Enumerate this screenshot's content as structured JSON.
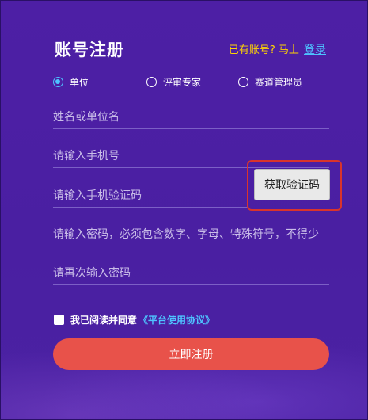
{
  "header": {
    "title": "账号注册",
    "login_hint": "已有账号? 马上",
    "login_link": "登录"
  },
  "roles": {
    "options": [
      "单位",
      "评审专家",
      "赛道管理员"
    ],
    "selected": "单位"
  },
  "fields": {
    "name_placeholder": "姓名或单位名",
    "phone_placeholder": "请输入手机号",
    "sms_code_placeholder": "请输入手机验证码",
    "password_placeholder": "请输入密码，必须包含数字、字母、特殊符号，不得少",
    "confirm_password_placeholder": "请再次输入密码"
  },
  "get_code_label": "获取验证码",
  "agreement": {
    "text": "我已阅读并同意",
    "link": "《平台使用协议》",
    "checked": false
  },
  "submit_label": "立即注册",
  "colors": {
    "background": "#4a1fa2",
    "accent_yellow": "#ffd400",
    "link_blue": "#4ec3ff",
    "submit_red": "#e8524a",
    "highlight_outline": "#d9342b"
  }
}
